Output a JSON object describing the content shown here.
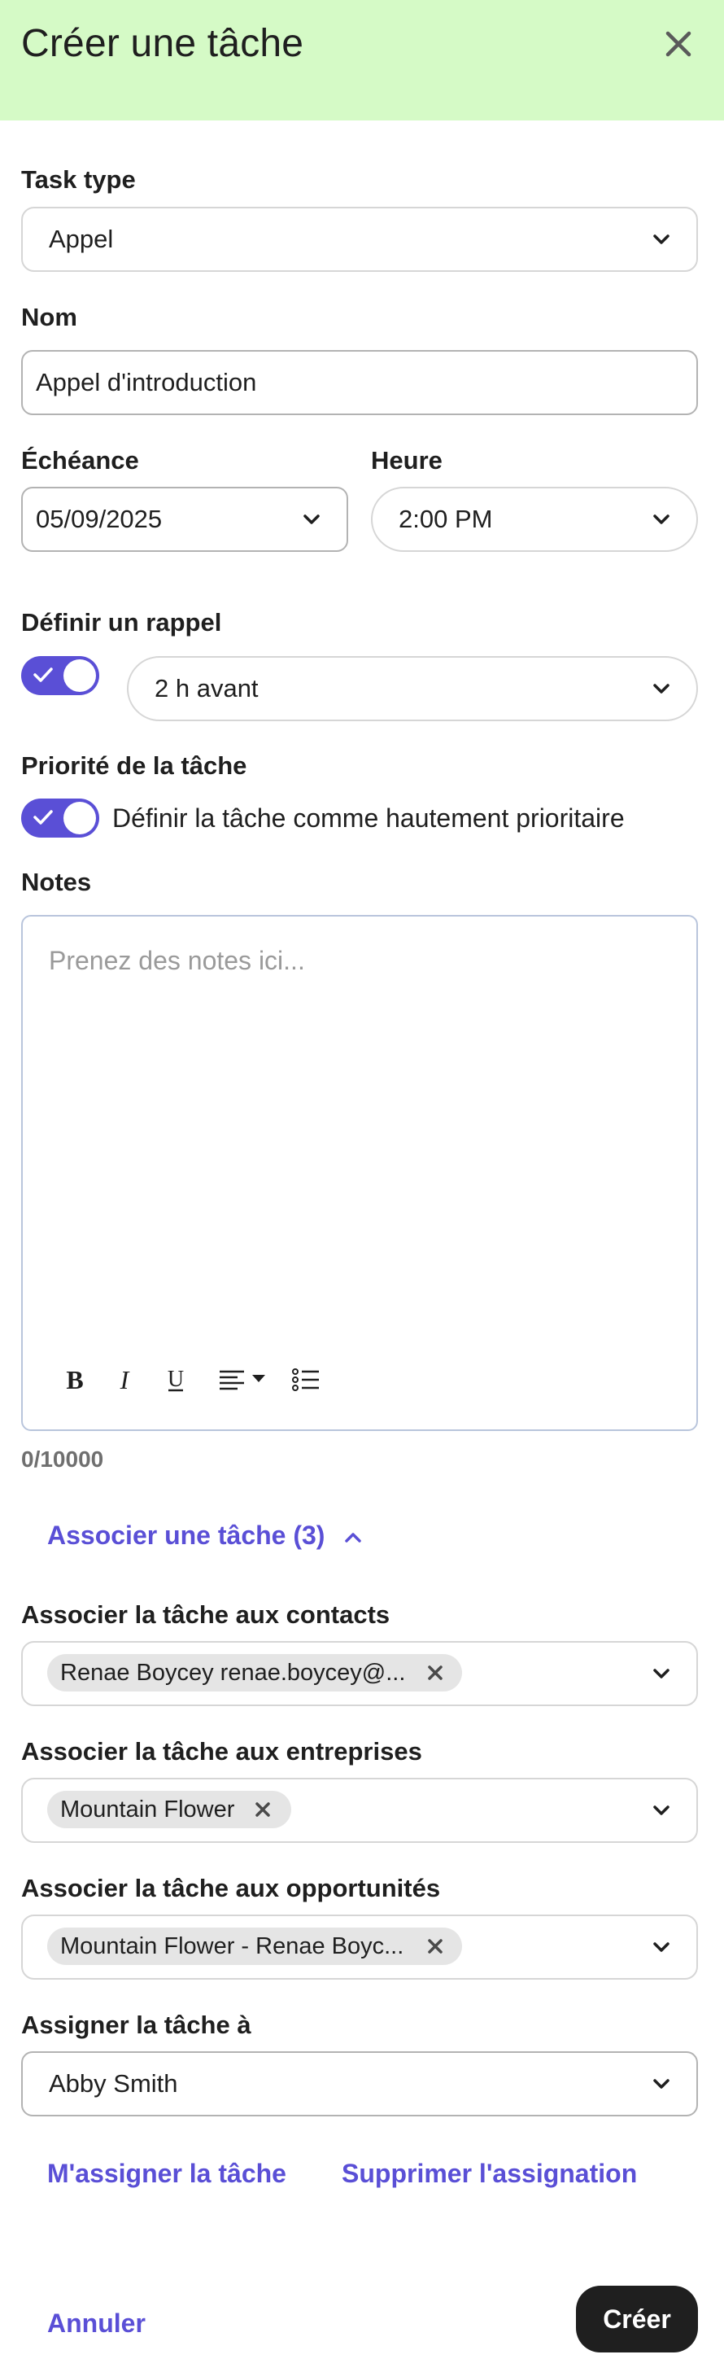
{
  "header": {
    "title": "Créer une tâche"
  },
  "icons": {
    "close": "close-icon",
    "chevron": "chevron-down-icon",
    "check": "check-icon"
  },
  "task_type": {
    "label": "Task type",
    "value": "Appel"
  },
  "name": {
    "label": "Nom",
    "value": "Appel d'introduction"
  },
  "due": {
    "label": "Échéance",
    "value": "05/09/2025"
  },
  "time": {
    "label": "Heure",
    "value": "2:00 PM"
  },
  "reminder": {
    "label": "Définir un rappel",
    "enabled": true,
    "value": "2 h avant"
  },
  "priority": {
    "label": "Priorité de la tâche",
    "enabled": true,
    "text": "Définir la tâche comme hautement prioritaire"
  },
  "notes": {
    "label": "Notes",
    "placeholder": "Prenez des notes ici...",
    "counter": "0/10000",
    "toolbar": [
      "bold",
      "italic",
      "underline",
      "align",
      "bulleted-list"
    ]
  },
  "associate": {
    "toggle_label": "Associer une tâche (3)",
    "contacts": {
      "label": "Associer la tâche aux contacts",
      "chip": "Renae Boycey renae.boycey@..."
    },
    "companies": {
      "label": "Associer la tâche aux entreprises",
      "chip": "Mountain Flower"
    },
    "deals": {
      "label": "Associer la tâche aux opportunités",
      "chip": "Mountain Flower - Renae Boyc..."
    }
  },
  "assignee": {
    "label": "Assigner la tâche à",
    "value": "Abby Smith",
    "assign_me": "M'assigner la tâche",
    "remove": "Supprimer l'assignation"
  },
  "footer": {
    "cancel": "Annuler",
    "create": "Créer"
  },
  "colors": {
    "header_bg": "#d5fac6",
    "accent": "#5a4fd6",
    "primary_button": "#1f1f1f"
  }
}
